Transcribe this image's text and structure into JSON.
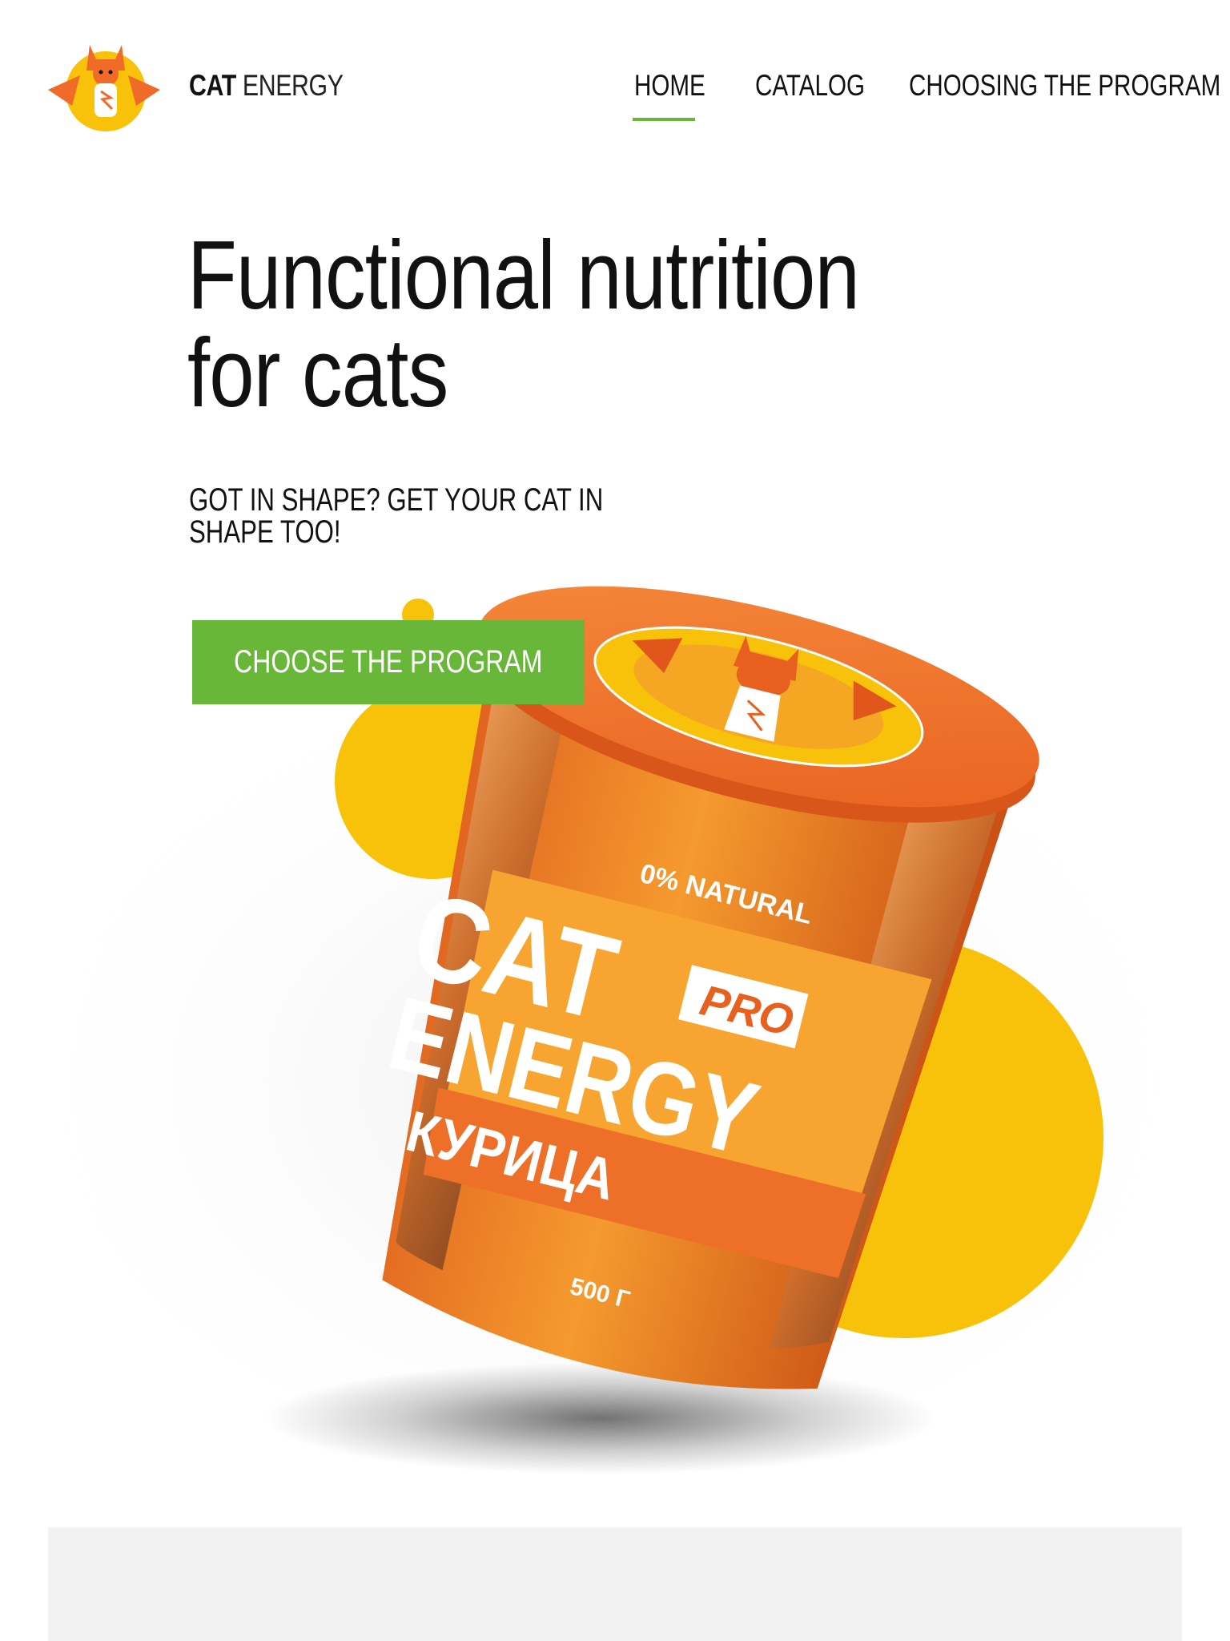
{
  "header": {
    "brand_bold": "CAT",
    "brand_light": "ENERGY",
    "nav": [
      {
        "label": "HOME",
        "active": true
      },
      {
        "label": "CATALOG",
        "active": false
      },
      {
        "label": "CHOOSING THE PROGRAM",
        "active": false
      }
    ]
  },
  "hero": {
    "title_line1": "Functional nutrition",
    "title_line2": "for cats",
    "subtitle_line1": "GOT IN SHAPE? GET YOUR CAT IN",
    "subtitle_line2": "SHAPE TOO!",
    "cta_label": "CHOOSE THE PROGRAM"
  },
  "product": {
    "label_natural": "0% NATURAL",
    "label_cat": "CAT",
    "label_pro": "PRO",
    "label_energy": "ENERGY",
    "label_flavor": "КУРИЦА",
    "label_weight": "500 Г"
  },
  "colors": {
    "accent_green": "#68b738",
    "orange": "#f06a28",
    "yellow": "#f8c20a",
    "panel_gray": "#f2f2f2"
  },
  "icons": {
    "logo": "superhero-cat-logo-icon"
  }
}
